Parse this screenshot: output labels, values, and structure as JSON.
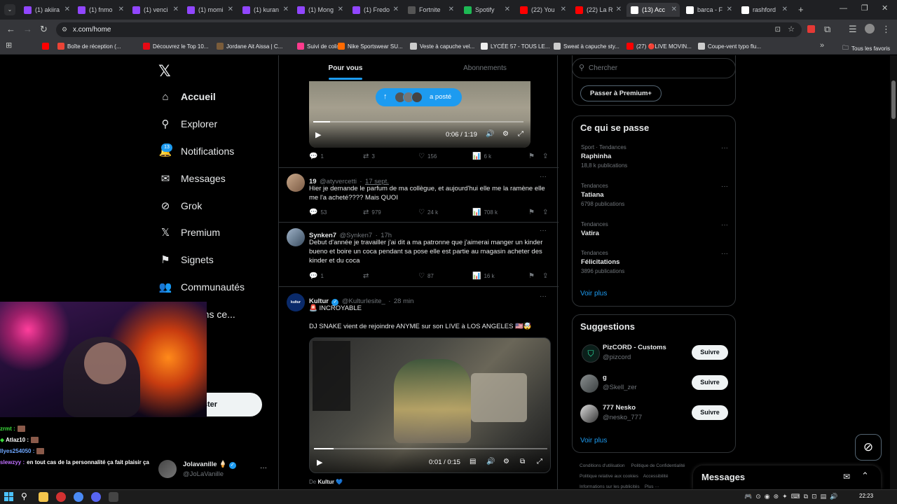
{
  "browser": {
    "tabs": [
      {
        "label": "(1) akiira",
        "favcolor": "#9146ff"
      },
      {
        "label": "(1) fnmo",
        "favcolor": "#9146ff"
      },
      {
        "label": "(1) venci",
        "favcolor": "#9146ff"
      },
      {
        "label": "(1) momi",
        "favcolor": "#9146ff"
      },
      {
        "label": "(1) kuran",
        "favcolor": "#9146ff"
      },
      {
        "label": "(1) Mong",
        "favcolor": "#9146ff"
      },
      {
        "label": "(1) Fredo",
        "favcolor": "#9146ff"
      },
      {
        "label": "Fortnite",
        "favcolor": "#555555"
      },
      {
        "label": "Spotify",
        "favcolor": "#1db954"
      },
      {
        "label": "(22) You",
        "favcolor": "#ff0000"
      },
      {
        "label": "(22) La R",
        "favcolor": "#ff0000"
      },
      {
        "label": "(13) Acc",
        "favcolor": "#ffffff"
      },
      {
        "label": "barca - F",
        "favcolor": "#ffffff"
      },
      {
        "label": "rashford",
        "favcolor": "#ffffff"
      }
    ],
    "new_tab": "+",
    "url": "x.com/home",
    "bookmarks": [
      {
        "label": "",
        "color": "#ff0000"
      },
      {
        "label": "Boîte de réception (...",
        "color": "#ea4335"
      },
      {
        "label": "Découvrez le Top 10...",
        "color": "#e50914"
      },
      {
        "label": "Jordane Ait Aissa | C...",
        "color": "#7a5c3a"
      },
      {
        "label": "Suivi de colis",
        "color": "#ff3b8d"
      },
      {
        "label": "Nike Sportswear SU...",
        "color": "#ff6a00"
      },
      {
        "label": "Veste à capuche vel...",
        "color": "#cccccc"
      },
      {
        "label": "LYCÉE 57 - TOUS LE...",
        "color": "#eeeeee"
      },
      {
        "label": "Sweat à capuche sty...",
        "color": "#cccccc"
      },
      {
        "label": "(27) 🔴LIVE MOVIN...",
        "color": "#ff0000"
      },
      {
        "label": "Coupe-vent typo flu...",
        "color": "#cccccc"
      }
    ],
    "all_bookmarks": "Tous les favoris"
  },
  "sidebar": {
    "logo": "𝕏",
    "items": [
      {
        "label": "Accueil",
        "icon": "home-icon",
        "glyph": "⌂"
      },
      {
        "label": "Explorer",
        "icon": "search-icon",
        "glyph": "⚲"
      },
      {
        "label": "Notifications",
        "icon": "bell-icon",
        "glyph": "🔔"
      },
      {
        "label": "Messages",
        "icon": "mail-icon",
        "glyph": "✉"
      },
      {
        "label": "Grok",
        "icon": "grok-icon",
        "glyph": "⊘"
      },
      {
        "label": "Premium",
        "icon": "x-premium-icon",
        "glyph": "𝕏"
      },
      {
        "label": "Signets",
        "icon": "bookmark-icon",
        "glyph": "⚑"
      },
      {
        "label": "Communautés",
        "icon": "communities-icon",
        "glyph": "👥"
      },
      {
        "label": "isations ce...",
        "icon": "",
        "glyph": ""
      }
    ],
    "notif_badge": "13",
    "post_button": "ster",
    "account": {
      "name": "Jolavanille",
      "emoji": "🍦",
      "handle": "@JoLaVanille",
      "more": "···"
    }
  },
  "feed": {
    "tabs": [
      "Pour vous",
      "Abonnements"
    ],
    "new_posts_pill": "a posté",
    "video1": {
      "time": "0:06 / 1:19"
    },
    "post0_actions": {
      "replies": "1",
      "reposts": "3",
      "likes": "156",
      "views": "6 k"
    },
    "posts": [
      {
        "name": "19",
        "handle": "@atyvercetti",
        "time": "17 sept.",
        "text": "Hier je demande le parfum de ma collègue, et aujourd'hui elle me la ramène elle me l'a acheté???? Mais QUOI",
        "replies": "53",
        "reposts": "979",
        "likes": "24 k",
        "views": "708 k"
      },
      {
        "name": "Synken7",
        "handle": "@Synken7",
        "time": "17h",
        "text": "Debut d'année je travailler j'ai dit a ma patronne que j'aimerai manger un kinder bueno et boire un coca pendant sa pose elle est partie au magasin acheter des kinder et du coca",
        "replies": "1",
        "reposts": "",
        "likes": "87",
        "views": "16 k"
      },
      {
        "name": "Kultur",
        "handle": "@Kulturlesite_",
        "time": "28 min",
        "line1": "🚨 INCROYABLE",
        "line2": "DJ SNAKE vient de rejoindre ANYME sur son LIVE à LOS ANGELES 🇺🇸🤯",
        "video_time": "0:01 / 0:15",
        "footer_prefix": "De",
        "footer_name": "Kultur 💙"
      }
    ]
  },
  "right": {
    "search_placeholder": "Chercher",
    "premium_button": "Passer à Premium+",
    "whats_happening": "Ce qui se passe",
    "trends": [
      {
        "context": "Sport · Tendances",
        "name": "Raphinha",
        "count": "18,8 k publications"
      },
      {
        "context": "Tendances",
        "name": "Tatiana",
        "count": "6798 publications"
      },
      {
        "context": "Tendances",
        "name": "Vatira",
        "count": ""
      },
      {
        "context": "Tendances",
        "name": "Félicitations",
        "count": "3896 publications"
      }
    ],
    "show_more": "Voir plus",
    "suggestions_title": "Suggestions",
    "suggestions": [
      {
        "name": "PizCORD - Customs",
        "handle": "@pizcord",
        "button": "Suivre"
      },
      {
        "name": "g",
        "handle": "@Skell_zer",
        "button": "Suivre"
      },
      {
        "name": "777 Nesko",
        "handle": "@nesko_777",
        "button": "Suivre"
      }
    ],
    "show_more2": "Voir plus",
    "footer1": "Conditions d'utilisation",
    "footer2": "Politique de Confidentialité",
    "footer3": "Politique relative aux cookies",
    "footer4": "Accessibilité",
    "footer5": "Informations sur les publicités",
    "footer6": "Plus ···",
    "messages_drawer": "Messages"
  },
  "overlay": {
    "chat": [
      {
        "user": "zrmt :",
        "color": "#3cdc3c",
        "msg": ""
      },
      {
        "user": "Atlaz10 :",
        "color": "#ffffff",
        "msg": ""
      },
      {
        "user": "Ilyes254050 :",
        "color": "#6fa8ff",
        "msg": ""
      },
      {
        "user": "slewzyy :",
        "color": "#c070ff",
        "msg": "en tout cas de la personnalité ça fait plaisir ça"
      }
    ]
  },
  "taskbar": {
    "time": "22:23"
  }
}
